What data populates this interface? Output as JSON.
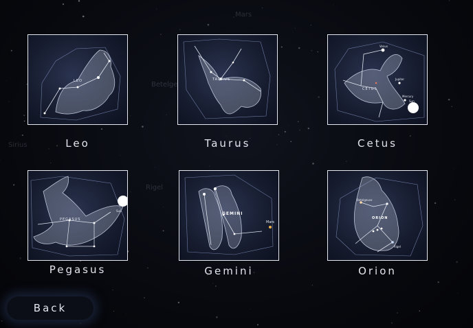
{
  "background_labels": [
    "Mars",
    "Betelgeuse",
    "Sirius",
    "Rigel"
  ],
  "constellations": [
    {
      "name": "Leo",
      "thumb_label": "LEO"
    },
    {
      "name": "Taurus",
      "thumb_label": "TAURUS"
    },
    {
      "name": "Cetus",
      "thumb_label": "CETUS",
      "thumb_extras": [
        "Venus",
        "Jupiter",
        "Mercury",
        "Sun"
      ]
    },
    {
      "name": "Pegasus",
      "thumb_label": "PEGASUS",
      "thumb_extras": [
        "Sun"
      ]
    },
    {
      "name": "Gemini",
      "thumb_label": "GEMINI",
      "thumb_extras": [
        "Mars"
      ]
    },
    {
      "name": "Orion",
      "thumb_label": "ORION",
      "thumb_extras": [
        "Betelgeuse",
        "Rigel"
      ]
    }
  ],
  "back_button": {
    "label": "Back"
  },
  "colors": {
    "accent": "#e6e9f0",
    "background": "#07080d"
  }
}
